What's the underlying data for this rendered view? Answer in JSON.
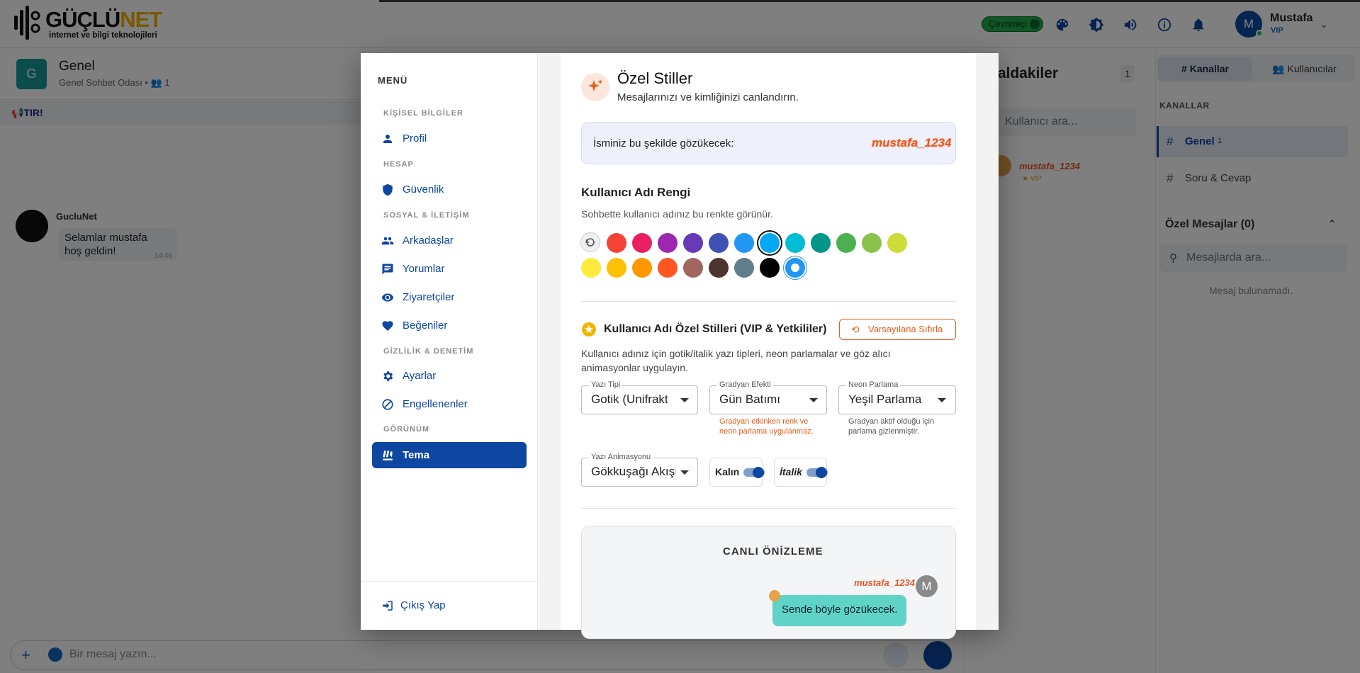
{
  "header": {
    "logo_main": "GÜÇLÜ",
    "logo_accent": "NET",
    "logo_sub": "internet ve bilgi teknolojileri",
    "status": "Çevrimiçi",
    "user_name": "Mustafa",
    "user_initial": "M",
    "user_tier": "VIP"
  },
  "chat": {
    "channel_initial": "G",
    "channel_name": "Genel",
    "channel_sub": "Genel Sohbet Odası",
    "channel_count": "1",
    "announce": "TIR!",
    "message": {
      "author": "GucluNet",
      "text": "Selamlar mustafa hoş geldin!",
      "time": "14:46"
    },
    "composer_placeholder": "Bir mesaj yazın..."
  },
  "online": {
    "title": "naldakiler",
    "count": "1",
    "search_placeholder": "Kullanıcı ara...",
    "user": "mustafa_1234",
    "user_badge": "★ VIP"
  },
  "sidebar": {
    "tabs": [
      "Kanallar",
      "Kullanıcılar"
    ],
    "channels_header": "KANALLAR",
    "channels": [
      {
        "name": "Genel",
        "count": "1"
      },
      {
        "name": "Soru & Cevap"
      }
    ],
    "dm_header": "Özel Mesajlar (0)",
    "dm_search_placeholder": "Mesajlarda ara...",
    "dm_empty": "Mesaj bulunamadı."
  },
  "modal": {
    "menu_title": "MENÜ",
    "sections": [
      "KİŞİSEL BİLGİLER",
      "HESAP",
      "SOSYAL & İLETİŞİM",
      "GİZLİLİK & DENETİM",
      "GÖRÜNÜM"
    ],
    "items": {
      "profil": "Profil",
      "guvenlik": "Güvenlik",
      "arkadaslar": "Arkadaşlar",
      "yorumlar": "Yorumlar",
      "ziyaretciler": "Ziyaretçiler",
      "begeniler": "Beğeniler",
      "ayarlar": "Ayarlar",
      "engellenenler": "Engellenenler",
      "tema": "Tema"
    },
    "logout": "Çıkış Yap",
    "content": {
      "title": "Özel Stiller",
      "subtitle": "Mesajlarınızı ve kimliğinizi canlandırın.",
      "name_label": "İsminiz bu şekilde gözükecek:",
      "name_value": "mustafa_1234",
      "color_header": "Kullanıcı Adı Rengi",
      "color_sub": "Sohbette kullanıcı adınız bu renkte görünür.",
      "swatches": [
        "#f44336",
        "#e91e63",
        "#9c27b0",
        "#673ab7",
        "#3f51b5",
        "#2196f3",
        "#03a9f4",
        "#00bcd4",
        "#009688",
        "#4caf50",
        "#8bc34a",
        "#cddc39",
        "#ffeb3b",
        "#ffc107",
        "#ff9800",
        "#ff5722",
        "#a1665e",
        "#4e342e",
        "#607d8b",
        "#000000",
        "#2196f3"
      ],
      "selected_swatch": "#03a9f4",
      "styles_header": "Kullanıcı Adı Özel Stilleri (VIP & Yetkililer)",
      "reset_button": "Varsayılana Sıfırla",
      "styles_desc": "Kullanıcı adınız için gotik/italik yazı tipleri, neon parlamalar ve göz alıcı animasyonlar uygulayın.",
      "font_label": "Yazı Tipi",
      "font_value": "Gotik (Unifrakt",
      "gradient_label": "Gradyan Efekti",
      "gradient_value": "Gün Batımı",
      "gradient_hint": "Gradyan etkinken renk ve neon parlama uygulanmaz.",
      "neon_label": "Neon Parlama",
      "neon_value": "Yeşil Parlama",
      "neon_hint": "Gradyan aktif olduğu için parlama gizlenmiştir.",
      "anim_label": "Yazı Animasyonu",
      "anim_value": "Gökkuşağı Akışı",
      "bold_label": "Kalın",
      "italic_label": "İtalik",
      "bold_on": true,
      "italic_on": true,
      "preview_title": "CANLI ÖNİZLEME",
      "preview_name": "mustafa_1234",
      "preview_initial": "M",
      "preview_text": "Sende böyle gözükecek."
    }
  }
}
